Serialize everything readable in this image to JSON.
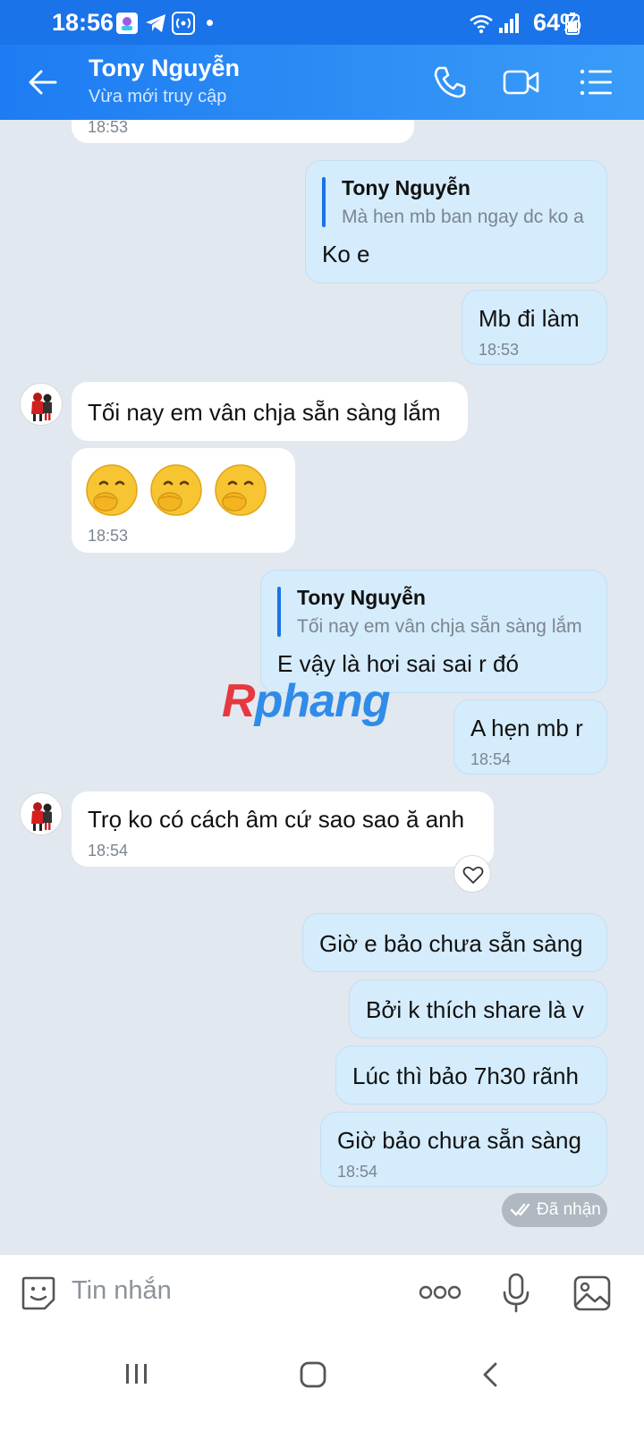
{
  "status_bar": {
    "time": "18:56",
    "battery": "64%"
  },
  "header": {
    "contact_name": "Tony Nguyễn",
    "status": "Vừa mới truy cập"
  },
  "messages": {
    "m0": {
      "time": "18:53"
    },
    "m1": {
      "quote_name": "Tony Nguyễn",
      "quote_text": "Mà hen mb ban ngay dc ko a",
      "text": "Ko e"
    },
    "m2": {
      "text": "Mb đi làm",
      "time": "18:53"
    },
    "m3": {
      "text": "Tối nay em vân chja sẵn sàng lắm"
    },
    "m4": {
      "time": "18:53"
    },
    "m5": {
      "quote_name": "Tony Nguyễn",
      "quote_text": "Tối nay em vân chja sẵn sàng lắm",
      "text": "E vậy là hơi sai sai r đó"
    },
    "m6": {
      "text": "A hẹn mb r",
      "time": "18:54"
    },
    "m7": {
      "text": "Trọ ko có cách âm cứ sao sao ă anh",
      "time": "18:54"
    },
    "m8": {
      "text": "Giờ e bảo chưa sẵn sàng"
    },
    "m9": {
      "text": "Bởi k thích share là v"
    },
    "m10": {
      "text": "Lúc thì bảo 7h30 rãnh"
    },
    "m11": {
      "text": "Giờ bảo chưa sẵn sàng",
      "time": "18:54"
    }
  },
  "delivery_status": "Đã nhận",
  "watermark": {
    "first": "R",
    "rest": "phang"
  },
  "composer": {
    "placeholder": "Tin nhắn"
  },
  "icons": {
    "back": "arrow-left-icon",
    "call": "phone-icon",
    "video": "video-camera-icon",
    "menu": "list-menu-icon",
    "emoji": "sticker-icon",
    "more": "more-dots-icon",
    "mic": "microphone-icon",
    "gallery": "image-icon",
    "reaction": "heart-icon",
    "emoji_reply": "face-with-hand-over-mouth-emoji"
  },
  "colors": {
    "header": "#1d7cf2",
    "outgoing_bubble": "#d5ecfc",
    "incoming_bubble": "#ffffff",
    "background": "#e2e8f0",
    "accent": "#1a73e8"
  }
}
